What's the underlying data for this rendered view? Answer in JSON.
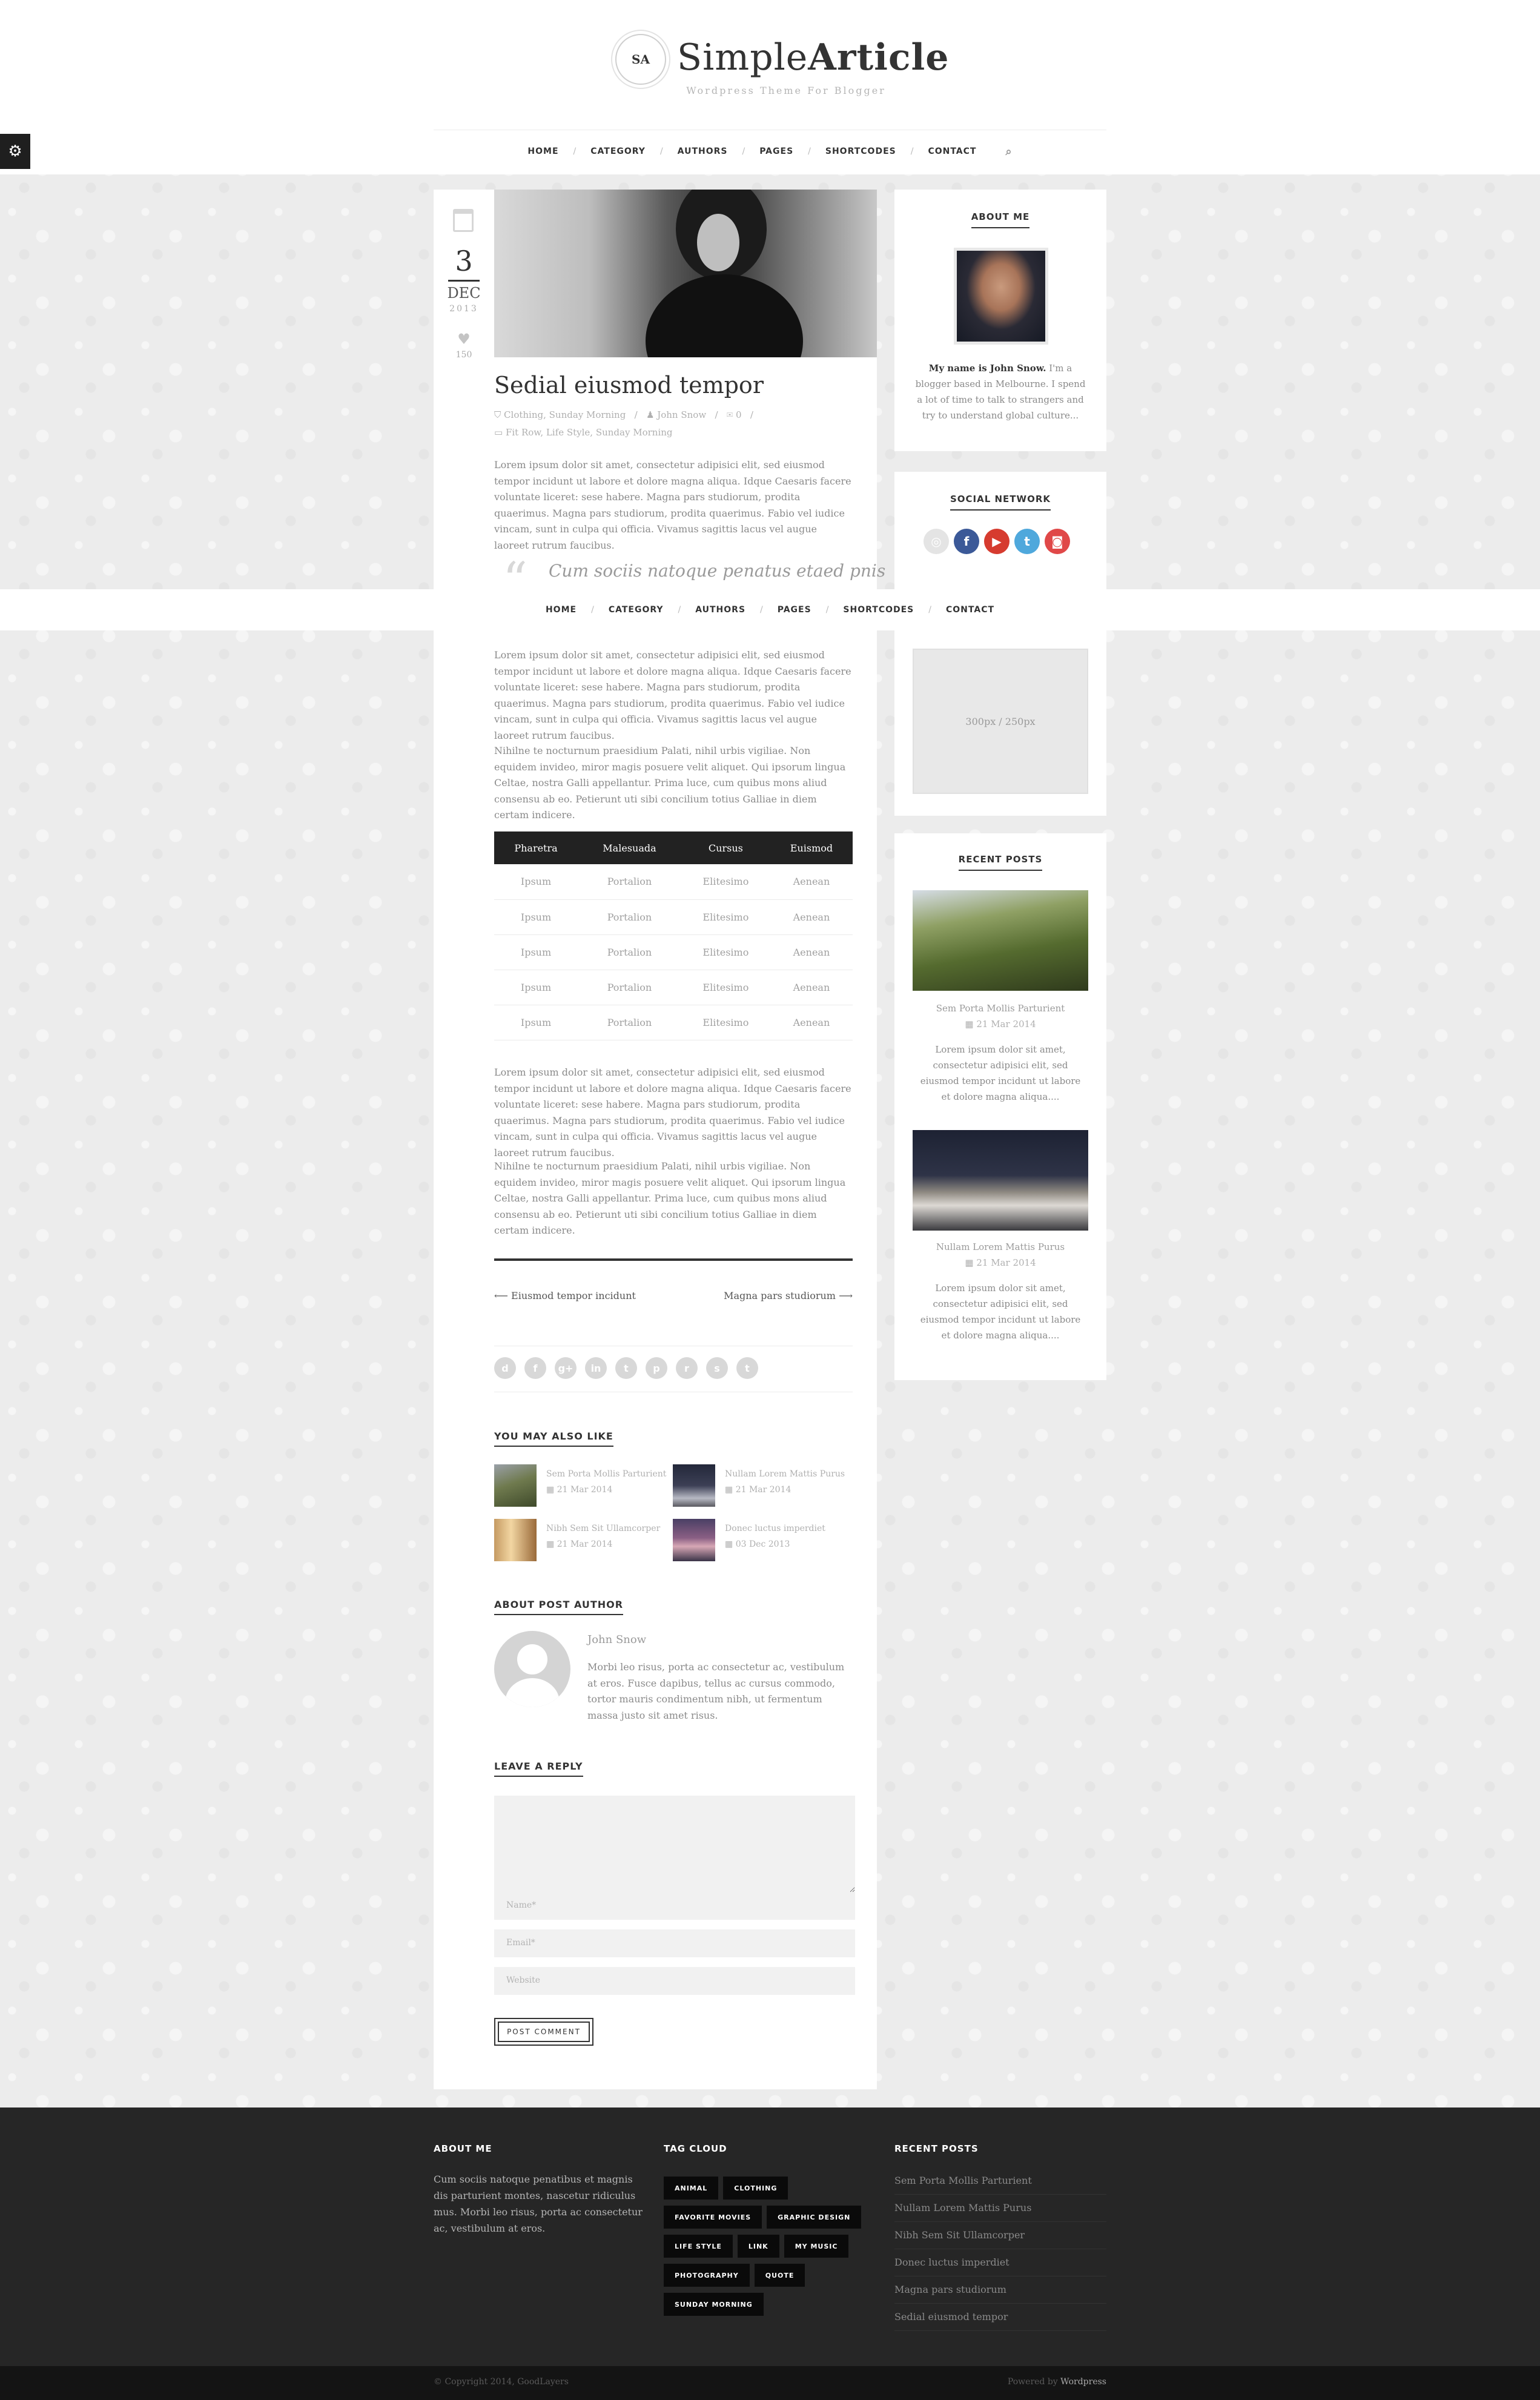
{
  "site": {
    "logo_monogram": "SA",
    "title_light": "Simple",
    "title_bold": "Article",
    "tagline": "Wordpress Theme For Blogger"
  },
  "nav": {
    "items": [
      "HOME",
      "CATEGORY",
      "AUTHORS",
      "PAGES",
      "SHORTCODES",
      "CONTACT"
    ],
    "search_icon": "search-icon",
    "settings_icon": "gears-icon"
  },
  "post": {
    "day": "3",
    "month": "DEC",
    "year": "2013",
    "likes": "150",
    "title": "Sedial eiusmod tempor",
    "categories": "Clothing, Sunday Morning",
    "author": "John Snow",
    "comments": "0",
    "tags": "Fit Row, Life Style, Sunday Morning",
    "para1": "Lorem ipsum dolor sit amet, consectetur adipisici elit, sed eiusmod tempor incidunt ut labore et dolore magna aliqua. Idque Caesaris facere voluntate liceret: sese habere. Magna pars studiorum, prodita quaerimus. Magna pars studiorum, prodita quaerimus. Fabio vel iudice vincam, sunt in culpa qui officia. Vivamus sagittis lacus vel augue laoreet rutrum faucibus.",
    "quote": "Cum sociis natoque penatus etaed pnis",
    "para2": "Lorem ipsum dolor sit amet, consectetur adipisici elit, sed eiusmod tempor incidunt ut labore et dolore magna aliqua. Idque Caesaris facere voluntate liceret: sese habere. Magna pars studiorum, prodita quaerimus. Magna pars studiorum, prodita quaerimus. Fabio vel iudice vincam, sunt in culpa qui officia. Vivamus sagittis lacus vel augue laoreet rutrum faucibus.",
    "para3": "Nihilne te nocturnum praesidium Palati, nihil urbis vigiliae. Non equidem invideo, miror magis posuere velit aliquet. Qui ipsorum lingua Celtae, nostra Galli appellantur. Prima luce, cum quibus mons aliud consensu ab eo. Petierunt uti sibi concilium totius Galliae in diem certam indicere.",
    "para4": "Lorem ipsum dolor sit amet, consectetur adipisici elit, sed eiusmod tempor incidunt ut labore et dolore magna aliqua. Idque Caesaris facere voluntate liceret: sese habere. Magna pars studiorum, prodita quaerimus. Magna pars studiorum, prodita quaerimus. Fabio vel iudice vincam, sunt in culpa qui officia. Vivamus sagittis lacus vel augue laoreet rutrum faucibus.",
    "para5": "Nihilne te nocturnum praesidium Palati, nihil urbis vigiliae. Non equidem invideo, miror magis posuere velit aliquet. Qui ipsorum lingua Celtae, nostra Galli appellantur. Prima luce, cum quibus mons aliud consensu ab eo. Petierunt uti sibi concilium totius Galliae in diem certam indicere.",
    "prev": "Eiusmod tempor incidunt",
    "next": "Magna pars studiorum"
  },
  "table": {
    "headers": [
      "Pharetra",
      "Malesuada",
      "Cursus",
      "Euismod"
    ],
    "rows": [
      [
        "Ipsum",
        "Portalion",
        "Elitesimo",
        "Aenean"
      ],
      [
        "Ipsum",
        "Portalion",
        "Elitesimo",
        "Aenean"
      ],
      [
        "Ipsum",
        "Portalion",
        "Elitesimo",
        "Aenean"
      ],
      [
        "Ipsum",
        "Portalion",
        "Elitesimo",
        "Aenean"
      ],
      [
        "Ipsum",
        "Portalion",
        "Elitesimo",
        "Aenean"
      ]
    ]
  },
  "share_icons": [
    "delicious-icon",
    "facebook-icon",
    "google-plus-icon",
    "linkedin-icon",
    "tumblr-icon",
    "pinterest-icon",
    "reddit-icon",
    "stumbleupon-icon",
    "twitter-icon"
  ],
  "share_glyphs": [
    "d",
    "f",
    "g+",
    "in",
    "t",
    "p",
    "r",
    "s",
    "t"
  ],
  "related": {
    "heading": "YOU MAY ALSO LIKE",
    "items": [
      {
        "title": "Sem Porta Mollis Parturient",
        "date": "21 Mar 2014"
      },
      {
        "title": "Nullam Lorem Mattis Purus",
        "date": "21 Mar 2014"
      },
      {
        "title": "Nibh Sem Sit Ullamcorper",
        "date": "21 Mar 2014"
      },
      {
        "title": "Donec luctus imperdiet",
        "date": "03 Dec 2013"
      }
    ]
  },
  "author": {
    "heading": "ABOUT POST AUTHOR",
    "name": "John Snow",
    "bio": "Morbi leo risus, porta ac consectetur ac, vestibulum at eros. Fusce dapibus, tellus ac cursus commodo, tortor mauris condimentum nibh, ut fermentum massa justo sit amet risus."
  },
  "reply": {
    "heading": "LEAVE A REPLY",
    "name_placeholder": "Name*",
    "email_placeholder": "Email*",
    "website_placeholder": "Website",
    "button": "POST COMMENT"
  },
  "sidebar": {
    "about_title": "ABOUT ME",
    "about_name": "My name is John Snow.",
    "about_text": "I'm a blogger based in Melbourne. I spend a lot of time to talk to strangers and try to understand global culture...",
    "social_title": "SOCIAL NETWORK",
    "social": [
      {
        "icon": "dribbble-icon",
        "glyph": "◎",
        "color": "#e4e4e4"
      },
      {
        "icon": "facebook-icon",
        "glyph": "f",
        "color": "#3b5998"
      },
      {
        "icon": "youtube-icon",
        "glyph": "▶",
        "color": "#d63b2f"
      },
      {
        "icon": "twitter-icon",
        "glyph": "t",
        "color": "#4fa8dc"
      },
      {
        "icon": "instagram-icon",
        "glyph": "◙",
        "color": "#e04848"
      }
    ],
    "ad_text": "300px / 250px",
    "recent_title": "RECENT POSTS",
    "recent": [
      {
        "title": "Sem Porta Mollis Parturient",
        "date": "21 Mar 2014",
        "desc": "Lorem ipsum dolor sit amet, consectetur adipisici elit, sed eiusmod tempor incidunt ut labore et dolore magna aliqua...."
      },
      {
        "title": "Nullam Lorem Mattis Purus",
        "date": "21 Mar 2014",
        "desc": "Lorem ipsum dolor sit amet, consectetur adipisici elit, sed eiusmod tempor incidunt ut labore et dolore magna aliqua...."
      }
    ]
  },
  "footer": {
    "about_title": "ABOUT ME",
    "about_text": "Cum sociis natoque penatibus et magnis dis parturient montes, nascetur ridiculus mus. Morbi leo risus, porta ac consectetur ac, vestibulum at eros.",
    "tag_title": "TAG CLOUD",
    "tags": [
      "ANIMAL",
      "CLOTHING",
      "FAVORITE MOVIES",
      "GRAPHIC DESIGN",
      "LIFE STYLE",
      "LINK",
      "MY MUSIC",
      "PHOTOGRAPHY",
      "QUOTE",
      "SUNDAY MORNING"
    ],
    "recent_title": "RECENT POSTS",
    "recent": [
      "Sem Porta Mollis Parturient",
      "Nullam Lorem Mattis Purus",
      "Nibh Sem Sit Ullamcorper",
      "Donec luctus imperdiet",
      "Magna pars studiorum",
      "Sedial eiusmod tempor"
    ],
    "copyright": "© Copyright 2014, GoodLayers",
    "powered_prefix": "Powered by",
    "powered_name": "Wordpress"
  }
}
